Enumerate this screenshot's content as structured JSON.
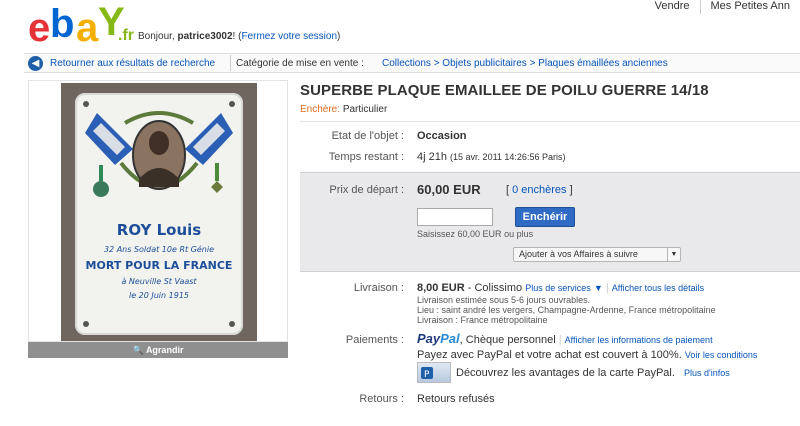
{
  "header": {
    "logo_alt": "ebay.fr",
    "logo": {
      "e": "e",
      "b": "b",
      "a": "a",
      "y": "Y",
      "fr": ".fr"
    },
    "greeting_prefix": "Bonjour,",
    "username": "patrice3002",
    "greeting_suffix": "!",
    "logout_open": "(",
    "logout_link": "Fermez votre session",
    "logout_close": ")",
    "topnav": [
      "Vendre",
      "Mes Petites Ann"
    ]
  },
  "breadcrumb": {
    "back_label": "Retourner aux résultats de recherche",
    "category_label": "Catégorie de mise en vente :",
    "path": "Collections > Objets publicitaires > Plaques émaillées anciennes"
  },
  "image": {
    "enlarge_label": "Agrandir",
    "plaque": {
      "name": "ROY Louis",
      "line1": "32 Ans Soldat   10e Rt Génie",
      "line2": "MORT POUR LA FRANCE",
      "line3": "à Neuville St Vaast",
      "line4": "le 20 Juin  1915"
    }
  },
  "listing": {
    "title": "SUPERBE PLAQUE EMAILLEE DE POILU GUERRE 14/18",
    "type_label": "Enchère:",
    "type_value": "Particulier",
    "condition_label": "Etat de l'objet :",
    "condition_value": "Occasion",
    "time_label": "Temps restant :",
    "time_value": "4j 21h",
    "time_detail": "(15 avr. 2011 14:26:56 Paris)",
    "start_price_label": "Prix de départ :",
    "start_price": "60,00 EUR",
    "bids_open": "[",
    "bids_link": "0 enchères",
    "bids_close": "]",
    "bid_input_value": "",
    "bid_button": "Enchérir",
    "bid_hint_prefix": "Saisissez 60,00 EUR",
    "bid_hint_suffix": "ou plus",
    "watch_button": "Ajouter à vos Affaires à suivre",
    "shipping_label": "Livraison :",
    "shipping_price": "8,00 EUR",
    "shipping_method": "- Colissimo",
    "more_services": "Plus de services",
    "show_all": "Afficher tous les détails",
    "shipping_note1": "Livraison estimée sous 5-6 jours ouvrables.",
    "shipping_note2": "Lieu : saint andré les vergers, Champagne-Ardenne, France métropolitaine",
    "shipping_note3": "Livraison : France métropolitaine",
    "payment_label": "Paiements :",
    "paypal_logo_pay": "Pay",
    "paypal_logo_pal": "Pal",
    "payment_methods": ", Chèque personnel",
    "payment_info_link": "Afficher les informations de paiement",
    "paypal_cover_text": "Payez avec PayPal et votre achat est couvert à 100%.",
    "conditions_link": "Voir les conditions",
    "card_text": "Découvrez les avantages de la carte PayPal.",
    "more_info_link": "Plus d'infos",
    "returns_label": "Retours :",
    "returns_value": "Retours refusés"
  },
  "colors": {
    "link": "#0654ba",
    "auction_orange": "#dd6c1f",
    "bid_button": "#2f6bc4",
    "price_box": "#e9e9ec"
  },
  "icons": [
    "back-arrow-icon",
    "magnifier-icon",
    "dropdown-arrow-icon",
    "paypal-card-icon"
  ]
}
